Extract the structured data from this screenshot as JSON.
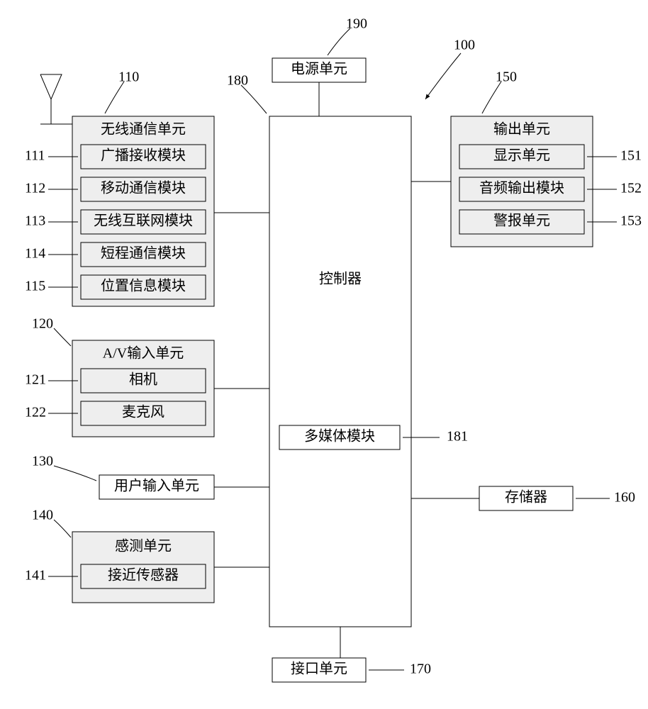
{
  "refnums": {
    "device": "100",
    "power": "190",
    "controller": "180",
    "multimedia": "181",
    "wireless": "110",
    "broadcast": "111",
    "mobile": "112",
    "internet": "113",
    "shortrange": "114",
    "location": "115",
    "av": "120",
    "camera": "121",
    "mic": "122",
    "userinput": "130",
    "sensing": "140",
    "proximity": "141",
    "output": "150",
    "display": "151",
    "audio": "152",
    "alarm": "153",
    "storage": "160",
    "interface": "170"
  },
  "labels": {
    "power": "电源单元",
    "controller": "控制器",
    "multimedia": "多媒体模块",
    "wireless": "无线通信单元",
    "broadcast": "广播接收模块",
    "mobile": "移动通信模块",
    "internet": "无线互联网模块",
    "shortrange": "短程通信模块",
    "location": "位置信息模块",
    "av": "A/V输入单元",
    "camera": "相机",
    "mic": "麦克风",
    "userinput": "用户输入单元",
    "sensing": "感测单元",
    "proximity": "接近传感器",
    "output": "输出单元",
    "display": "显示单元",
    "audio": "音频输出模块",
    "alarm": "警报单元",
    "storage": "存储器",
    "interface": "接口单元"
  }
}
